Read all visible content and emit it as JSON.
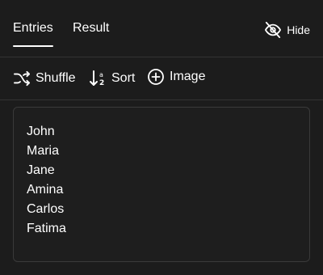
{
  "tabs": [
    {
      "label": "Entries",
      "active": true
    },
    {
      "label": "Result",
      "active": false
    }
  ],
  "hide_button": {
    "label": "Hide",
    "icon": "eye-off-icon"
  },
  "toolbar": {
    "shuffle": {
      "label": "Shuffle",
      "icon": "shuffle-icon"
    },
    "sort": {
      "label": "Sort",
      "icon": "sort-az-icon"
    },
    "image": {
      "label": "Image",
      "icon": "plus-circle-icon"
    }
  },
  "entries": [
    "John",
    "Maria",
    "Jane",
    "Amina",
    "Carlos",
    "Fatima"
  ],
  "colors": {
    "background": "#1c1c1c",
    "text": "#ffffff",
    "border": "#3a3a3a",
    "divider": "#333333"
  }
}
